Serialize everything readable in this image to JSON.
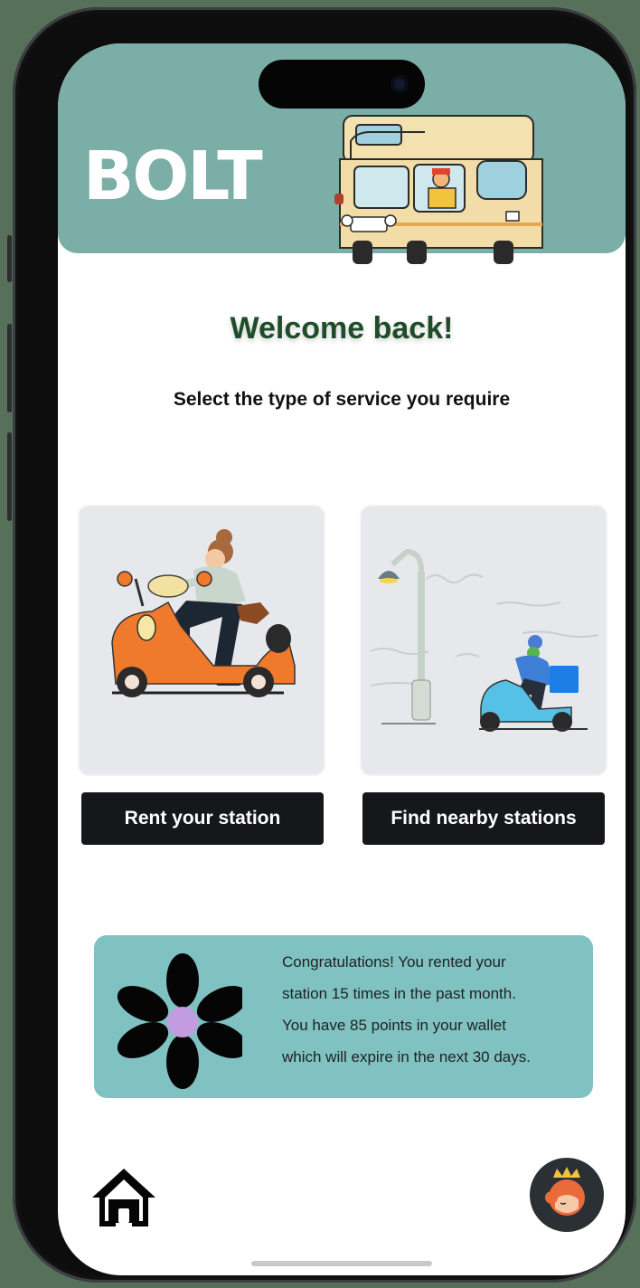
{
  "app": {
    "brand": "BOLT"
  },
  "main": {
    "welcome": "Welcome back!",
    "subtitle": "Select the type of service you require"
  },
  "services": [
    {
      "label": "Rent your station",
      "illustration": "scooter-rider-illustration"
    },
    {
      "label": "Find nearby stations",
      "illustration": "delivery-scooter-streetlamp-illustration"
    }
  ],
  "info_card": {
    "icon": "flower-icon",
    "lines": [
      "Congratulations! You rented your",
      "station 15 times in the past month.",
      "You have 85 points in your wallet",
      "which will expire in the next 30 days."
    ]
  },
  "bottom_nav": {
    "home_icon": "home-icon",
    "avatar_icon": "avatar"
  },
  "colors": {
    "header": "#7aaea6",
    "info_card": "#7fc2c1",
    "button": "#16171a",
    "welcome_text": "#1f4d2a"
  }
}
